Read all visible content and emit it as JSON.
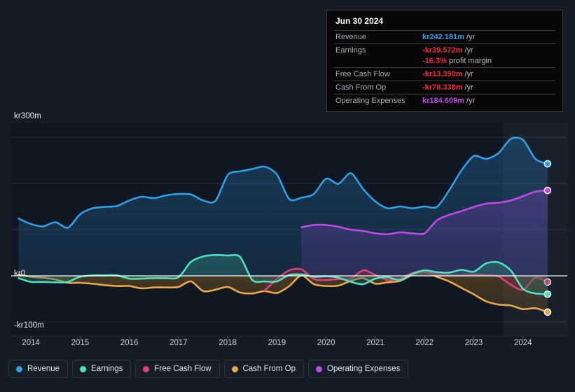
{
  "theme": {
    "background": "#141b25",
    "plot_background": "#101722",
    "gridline": "#3c4654",
    "zero_line": "#ffffff",
    "axis_text": "#c8d0db"
  },
  "tooltip": {
    "title": "Jun 30 2024",
    "rows": [
      {
        "key": "Revenue",
        "value": "kr242.181m",
        "unit": "/yr",
        "color": "#2f9fe8"
      },
      {
        "key": "Earnings",
        "value": "-kr39.572m",
        "unit": "/yr",
        "color": "#f2293a"
      },
      {
        "key": "",
        "value": "-16.3%",
        "unit": "profit margin",
        "color": "#f2293a"
      },
      {
        "key": "Free Cash Flow",
        "value": "-kr13.390m",
        "unit": "/yr",
        "color": "#f2293a"
      },
      {
        "key": "Cash From Op",
        "value": "-kr78.338m",
        "unit": "/yr",
        "color": "#f2293a"
      },
      {
        "key": "Operating Expenses",
        "value": "kr184.609m",
        "unit": "/yr",
        "color": "#c04ae8"
      }
    ]
  },
  "legend": {
    "items": [
      {
        "label": "Revenue",
        "color": "#2f9fe8"
      },
      {
        "label": "Earnings",
        "color": "#4fe0c0"
      },
      {
        "label": "Free Cash Flow",
        "color": "#d6427a"
      },
      {
        "label": "Cash From Op",
        "color": "#e8a84a"
      },
      {
        "label": "Operating Expenses",
        "color": "#c04ae8"
      }
    ]
  },
  "chart_data": {
    "type": "area",
    "title": "",
    "xlabel": "",
    "ylabel": "",
    "currency": "kr",
    "units": "millions per year (TTM)",
    "grid": true,
    "legend_position": "bottom",
    "ylim": [
      -130,
      330
    ],
    "y_ticks": [
      300,
      200,
      100,
      0,
      -100
    ],
    "y_tick_labels": [
      "kr300m",
      "kr200m",
      "kr100m",
      "kr0",
      "-kr100m"
    ],
    "y_tick_labels_shown": [
      "kr300m",
      "kr0",
      "-kr100m"
    ],
    "xlim": [
      "2013.6",
      "2024.9"
    ],
    "x_ticks": [
      2014,
      2015,
      2016,
      2017,
      2018,
      2019,
      2020,
      2021,
      2022,
      2023,
      2024
    ],
    "x_tick_labels": [
      "2014",
      "2015",
      "2016",
      "2017",
      "2018",
      "2019",
      "2020",
      "2021",
      "2022",
      "2023",
      "2024"
    ],
    "forecast_band_start": "2023.6",
    "series": [
      {
        "name": "Revenue",
        "color": "#2f9fe8",
        "fill": "rgba(37,105,160,0.42)",
        "x": [
          2013.75,
          2014.0,
          2014.25,
          2014.5,
          2014.75,
          2015.0,
          2015.25,
          2015.5,
          2015.75,
          2016.0,
          2016.25,
          2016.5,
          2016.75,
          2017.0,
          2017.25,
          2017.5,
          2017.75,
          2018.0,
          2018.25,
          2018.5,
          2018.75,
          2019.0,
          2019.25,
          2019.5,
          2019.75,
          2020.0,
          2020.25,
          2020.5,
          2020.75,
          2021.0,
          2021.25,
          2021.5,
          2021.75,
          2022.0,
          2022.25,
          2022.5,
          2022.75,
          2023.0,
          2023.25,
          2023.5,
          2023.75,
          2024.0,
          2024.25,
          2024.5
        ],
        "values": [
          124,
          112,
          107,
          116,
          104,
          133,
          146,
          149,
          151,
          163,
          171,
          168,
          174,
          177,
          176,
          163,
          162,
          218,
          226,
          231,
          236,
          219,
          166,
          169,
          177,
          210,
          199,
          222,
          188,
          161,
          146,
          150,
          146,
          150,
          149,
          185,
          228,
          259,
          253,
          265,
          296,
          294,
          253,
          242.181
        ],
        "end_marker": true
      },
      {
        "name": "Operating Expenses",
        "color": "#c04ae8",
        "fill": "rgba(90,62,150,0.52)",
        "x": [
          2019.5,
          2019.75,
          2020.0,
          2020.25,
          2020.5,
          2020.75,
          2021.0,
          2021.25,
          2021.5,
          2021.75,
          2022.0,
          2022.25,
          2022.5,
          2022.75,
          2023.0,
          2023.25,
          2023.5,
          2023.75,
          2024.0,
          2024.25,
          2024.5
        ],
        "values": [
          105,
          110,
          110,
          106,
          100,
          97,
          92,
          90,
          94,
          92,
          92,
          120,
          132,
          140,
          149,
          156,
          158,
          163,
          172,
          182,
          184.609
        ],
        "end_marker": true
      },
      {
        "name": "Earnings",
        "color": "#4fe0c0",
        "fill": "rgba(42,118,110,0.55)",
        "x": [
          2013.75,
          2014.0,
          2014.25,
          2014.5,
          2014.75,
          2015.0,
          2015.25,
          2015.5,
          2015.75,
          2016.0,
          2016.25,
          2016.5,
          2016.75,
          2017.0,
          2017.25,
          2017.5,
          2017.75,
          2018.0,
          2018.25,
          2018.5,
          2018.75,
          2019.0,
          2019.25,
          2019.5,
          2019.75,
          2020.0,
          2020.25,
          2020.5,
          2020.75,
          2021.0,
          2021.25,
          2021.5,
          2021.75,
          2022.0,
          2022.25,
          2022.5,
          2022.75,
          2023.0,
          2023.25,
          2023.5,
          2023.75,
          2024.0,
          2024.25,
          2024.5
        ],
        "values": [
          -5,
          -13,
          -13,
          -14,
          -13,
          -2,
          1,
          1,
          1,
          -6,
          -6,
          -5,
          -5,
          -3,
          30,
          42,
          45,
          44,
          41,
          -9,
          -12,
          -12,
          2,
          3,
          -2,
          -1,
          -4,
          -13,
          -18,
          -6,
          -3,
          -9,
          4,
          12,
          8,
          7,
          13,
          9,
          27,
          29,
          12,
          -28,
          -38,
          -39.572
        ],
        "end_marker": true
      },
      {
        "name": "Free Cash Flow",
        "color": "#d6427a",
        "fill": "rgba(123,37,62,0.62)",
        "x": [
          2018.75,
          2019.0,
          2019.25,
          2019.5,
          2019.75,
          2020.0,
          2020.25,
          2020.5,
          2020.75,
          2021.0,
          2021.25,
          2021.5,
          2021.75,
          2022.0,
          2022.25,
          2022.5,
          2022.75,
          2023.0,
          2023.25,
          2023.5,
          2023.75,
          2024.0,
          2024.25,
          2024.5
        ],
        "values": [
          -32,
          -7,
          12,
          14,
          -7,
          -9,
          -7,
          -6,
          12,
          2,
          -9,
          -6,
          6,
          10,
          3,
          1,
          1,
          3,
          2,
          -1,
          -19,
          -30,
          -4,
          -13.39
        ],
        "end_marker": true
      },
      {
        "name": "Cash From Op",
        "color": "#e8a84a",
        "fill": "rgba(118,86,36,0.55)",
        "x": [
          2013.75,
          2014.0,
          2014.25,
          2014.5,
          2014.75,
          2015.0,
          2015.25,
          2015.5,
          2015.75,
          2016.0,
          2016.25,
          2016.5,
          2016.75,
          2017.0,
          2017.25,
          2017.5,
          2017.75,
          2018.0,
          2018.25,
          2018.5,
          2018.75,
          2019.0,
          2019.25,
          2019.5,
          2019.75,
          2020.0,
          2020.25,
          2020.5,
          2020.75,
          2021.0,
          2021.25,
          2021.5,
          2021.75,
          2022.0,
          2022.25,
          2022.5,
          2022.75,
          2023.0,
          2023.25,
          2023.5,
          2023.75,
          2024.0,
          2024.25,
          2024.5
        ],
        "values": [
          3,
          -2,
          -4,
          -8,
          -15,
          -15,
          -17,
          -20,
          -22,
          -22,
          -27,
          -25,
          -25,
          -24,
          -12,
          -33,
          -30,
          -24,
          -36,
          -38,
          -33,
          -37,
          -22,
          1,
          -18,
          -22,
          -21,
          -11,
          -5,
          -17,
          -14,
          -11,
          2,
          8,
          -2,
          -12,
          -26,
          -40,
          -55,
          -62,
          -64,
          -72,
          -70,
          -78.338
        ],
        "end_marker": true
      }
    ]
  }
}
